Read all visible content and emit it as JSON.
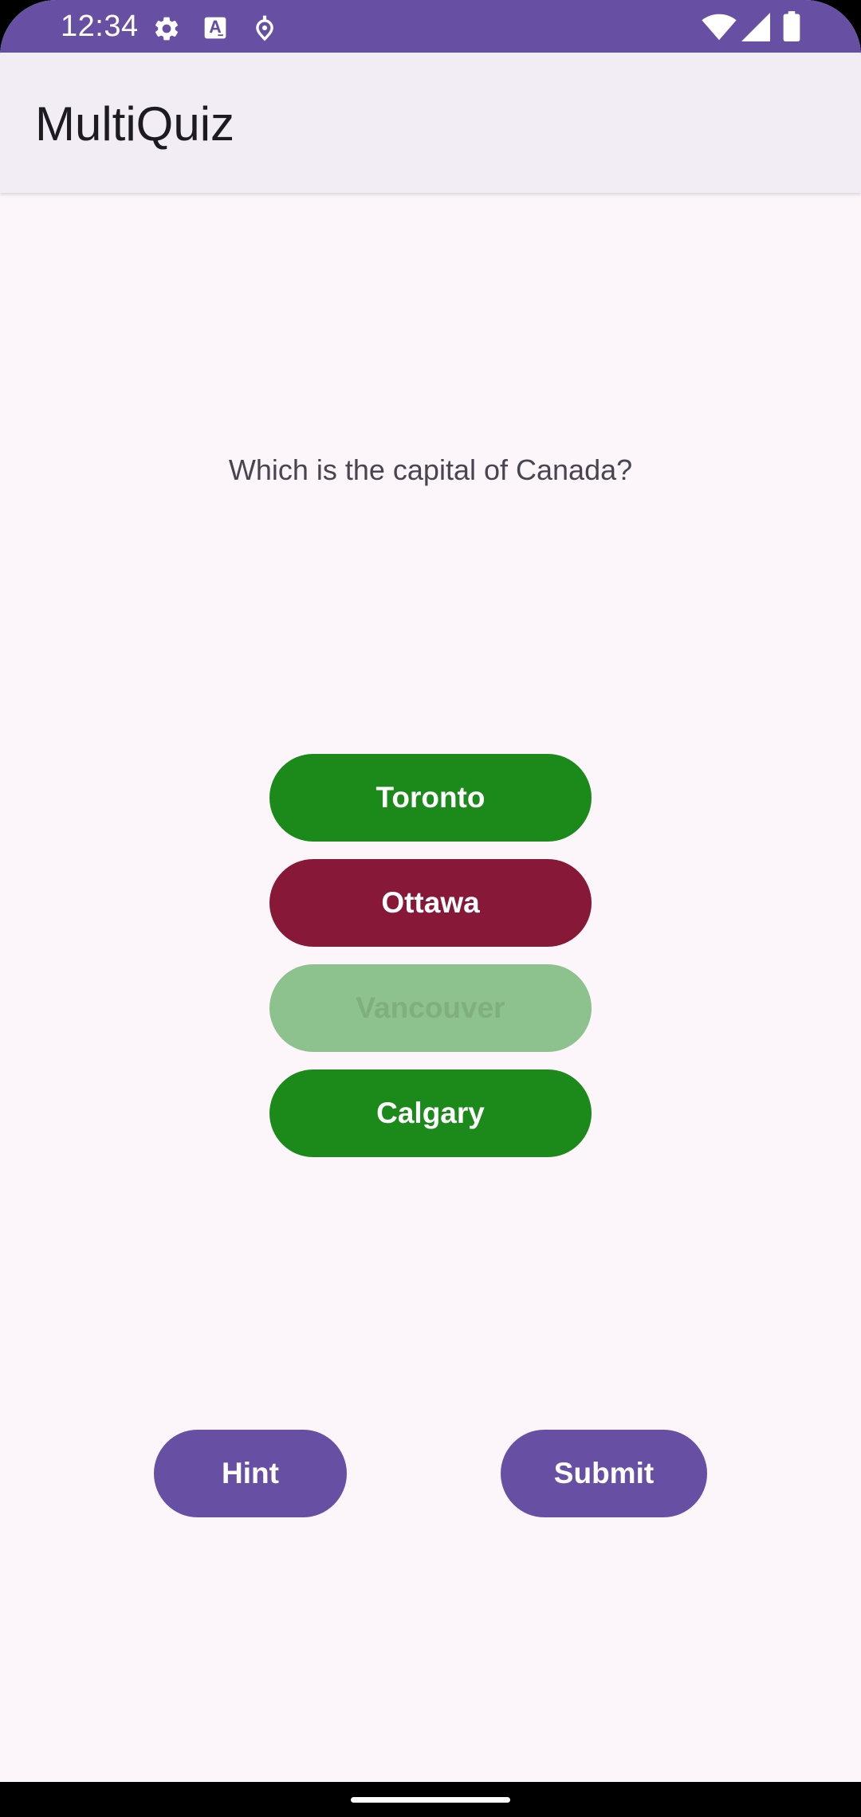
{
  "status_bar": {
    "time": "12:34",
    "left_icons": [
      "settings-icon",
      "text-a-icon",
      "location-pin-icon"
    ],
    "right_icons": [
      "wifi-icon",
      "signal-icon",
      "battery-icon"
    ]
  },
  "app_bar": {
    "title": "MultiQuiz"
  },
  "quiz": {
    "question": "Which is the capital of Canada?",
    "answers": [
      {
        "label": "Toronto",
        "state": "enabled",
        "color": "#1B8A1B"
      },
      {
        "label": "Ottawa",
        "state": "selected",
        "color": "#871838"
      },
      {
        "label": "Vancouver",
        "state": "disabled",
        "color": "#8DC18D"
      },
      {
        "label": "Calgary",
        "state": "enabled",
        "color": "#1B8A1B"
      }
    ]
  },
  "actions": {
    "hint_label": "Hint",
    "submit_label": "Submit"
  },
  "colors": {
    "primary": "#6750A4",
    "app_bar_bg": "#F2ECF5",
    "page_bg": "#FCF6FB"
  }
}
